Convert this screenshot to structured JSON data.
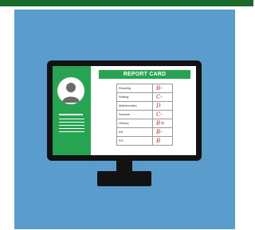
{
  "colors": {
    "top_bar": "#196b2b",
    "background": "#5a9ccc",
    "monitor": "#121212",
    "panel_green": "#27a452",
    "grade_red": "#e0262b"
  },
  "report_card": {
    "title": "REPORT CARD",
    "rows": [
      {
        "subject": "Reading",
        "grade": "B-"
      },
      {
        "subject": "Writing",
        "grade": "C-"
      },
      {
        "subject": "Mathematics",
        "grade": "D"
      },
      {
        "subject": "Science",
        "grade": "C-"
      },
      {
        "subject": "History",
        "grade": "B+"
      },
      {
        "subject": "Art",
        "grade": "B-"
      },
      {
        "subject": "P.E.",
        "grade": "B"
      }
    ]
  },
  "icons": {
    "avatar": "user-silhouette-icon"
  }
}
